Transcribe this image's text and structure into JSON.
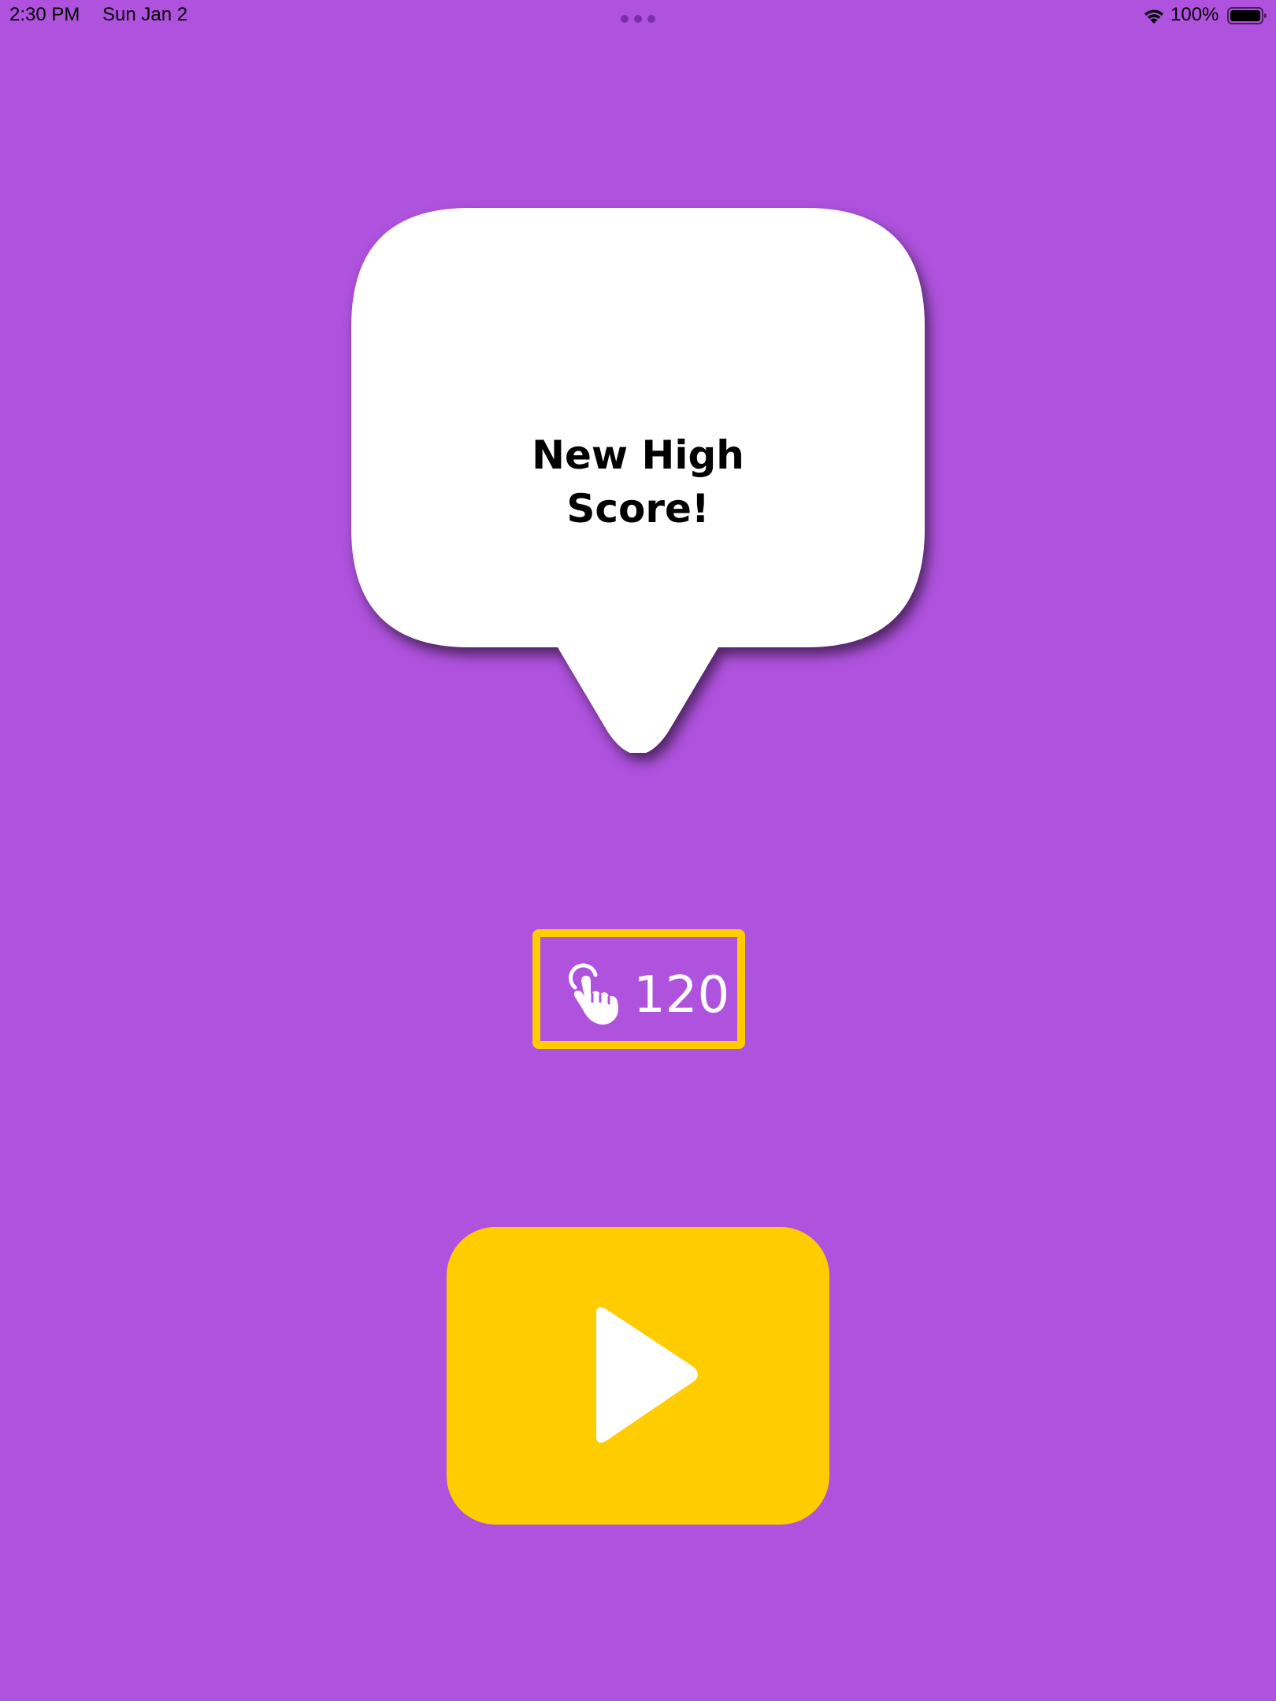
{
  "status_bar": {
    "time": "2:30 PM",
    "date": "Sun Jan 2",
    "battery_percent": "100%",
    "icons": [
      "wifi-icon",
      "battery-icon"
    ]
  },
  "bubble": {
    "text": "New High\nScore!"
  },
  "score": {
    "icon": "tap-hand-icon",
    "value": "120"
  },
  "play_button": {
    "icon": "play-icon"
  },
  "colors": {
    "background": "#af52de",
    "accent": "#ffcc00",
    "bubble": "#ffffff",
    "text_dark": "#000000",
    "text_light": "#ffffff"
  }
}
